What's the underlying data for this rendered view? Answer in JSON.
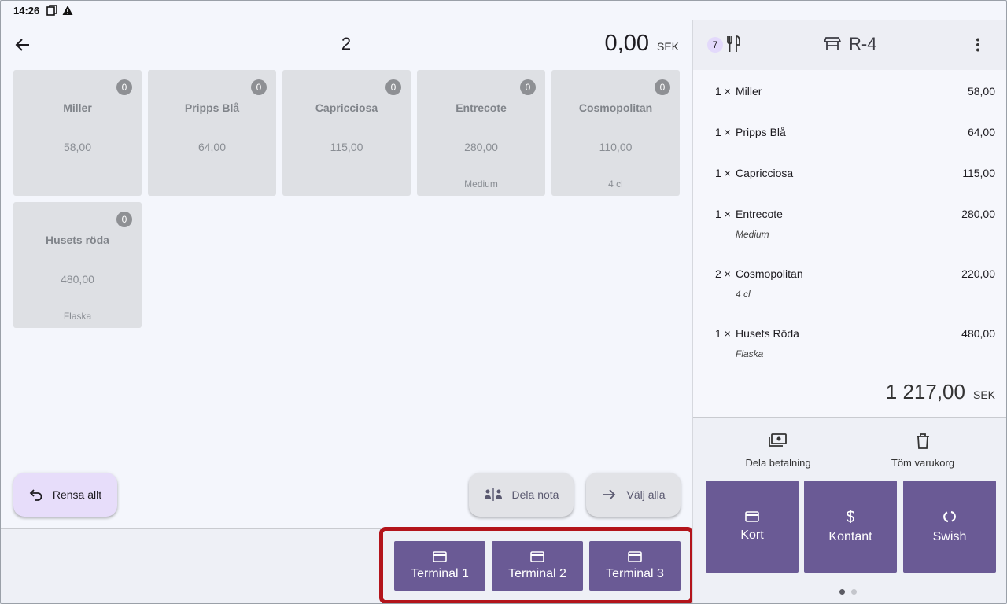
{
  "status_bar": {
    "time": "14:26"
  },
  "left": {
    "seat_number": "2",
    "amount": "0,00",
    "currency": "SEK",
    "products": [
      {
        "name": "Miller",
        "price": "58,00",
        "count": "0",
        "note": ""
      },
      {
        "name": "Pripps Blå",
        "price": "64,00",
        "count": "0",
        "note": ""
      },
      {
        "name": "Capricciosa",
        "price": "115,00",
        "count": "0",
        "note": ""
      },
      {
        "name": "Entrecote",
        "price": "280,00",
        "count": "0",
        "note": "Medium"
      },
      {
        "name": "Cosmopolitan",
        "price": "110,00",
        "count": "0",
        "note": "4 cl"
      },
      {
        "name": "Husets röda",
        "price": "480,00",
        "count": "0",
        "note": "Flaska"
      }
    ],
    "clear_all": "Rensa allt",
    "split_bill": "Dela nota",
    "select_all": "Välj alla",
    "terminals": [
      "Terminal 1",
      "Terminal 2",
      "Terminal 3"
    ]
  },
  "right": {
    "guest_count": "7",
    "table": "R-4",
    "order": [
      {
        "qty": "1 ×",
        "name": "Miller",
        "price": "58,00",
        "modifier": ""
      },
      {
        "qty": "1 ×",
        "name": "Pripps Blå",
        "price": "64,00",
        "modifier": ""
      },
      {
        "qty": "1 ×",
        "name": "Capricciosa",
        "price": "115,00",
        "modifier": ""
      },
      {
        "qty": "1 ×",
        "name": "Entrecote",
        "price": "280,00",
        "modifier": "Medium"
      },
      {
        "qty": "2 ×",
        "name": "Cosmopolitan",
        "price": "220,00",
        "modifier": "4 cl"
      },
      {
        "qty": "1 ×",
        "name": "Husets Röda",
        "price": "480,00",
        "modifier": "Flaska"
      }
    ],
    "total": "1 217,00",
    "currency": "SEK",
    "split_payment": "Dela betalning",
    "empty_cart": "Töm varukorg",
    "pay": {
      "card": "Kort",
      "cash": "Kontant",
      "swish": "Swish"
    }
  },
  "colors": {
    "primary": "#6a5a95",
    "highlight": "#b3141b",
    "fab_tonal": "#e7ddfa",
    "tile_bg": "#dee0e4"
  },
  "icons": {
    "back": "arrow-left-icon",
    "card": "credit-card-icon",
    "cash": "dollar-icon",
    "swish": "swish-icon",
    "split_payment": "cash-stack-icon",
    "empty_cart": "trash-icon",
    "more": "more-vertical-icon",
    "table": "table-icon",
    "cutlery": "cutlery-icon"
  }
}
